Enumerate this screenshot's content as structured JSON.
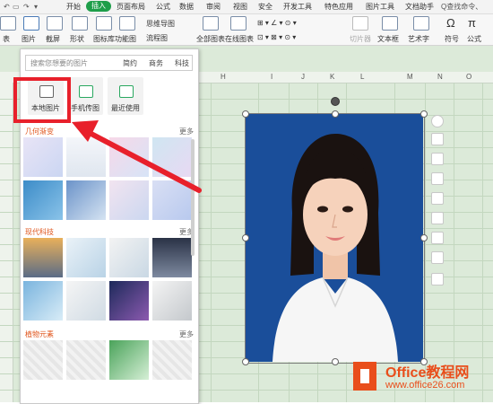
{
  "ribbon_tabs": [
    "开始",
    "插入",
    "页面布局",
    "公式",
    "数据",
    "审阅",
    "视图",
    "安全",
    "开发工具",
    "特色应用",
    "图片工具",
    "文档助手"
  ],
  "active_tab": "插入",
  "search_command": "Q查找命令、",
  "tools": {
    "table": "表",
    "picture": "图片",
    "screenshot": "截屏",
    "shape": "形状",
    "icon_lib": "图标库",
    "func_chart": "功能图",
    "mind_map": "思维导图",
    "flowchart": "流程图",
    "all_charts": "全部图表",
    "online_charts": "在线图表",
    "slicer": "切片器",
    "textbox": "文本框",
    "wordart": "艺术字",
    "symbol": "符号",
    "formula": "公式"
  },
  "columns": [
    "H",
    "I",
    "J",
    "K",
    "L",
    "M",
    "N",
    "O"
  ],
  "panel": {
    "search_placeholder": "搜索您想要的图片",
    "chips": [
      "简约",
      "商务",
      "科技"
    ],
    "sources": [
      {
        "label": "本地图片",
        "icon": "image-local-icon"
      },
      {
        "label": "手机传图",
        "icon": "phone-upload-icon"
      },
      {
        "label": "最近使用",
        "icon": "recent-image-icon"
      }
    ],
    "sections": [
      {
        "title": "几何渐变",
        "more": "更多"
      },
      {
        "title": "现代科技",
        "more": "更多"
      },
      {
        "title": "植物元素",
        "more": "更多"
      }
    ]
  },
  "watermark": {
    "line1": "Office教程网",
    "line2": "www.office26.com"
  },
  "colors": {
    "accent_green": "#1e9e4a",
    "highlight_red": "#e8202b",
    "photo_bg": "#1a4e9a",
    "section_title": "#e0561d"
  }
}
